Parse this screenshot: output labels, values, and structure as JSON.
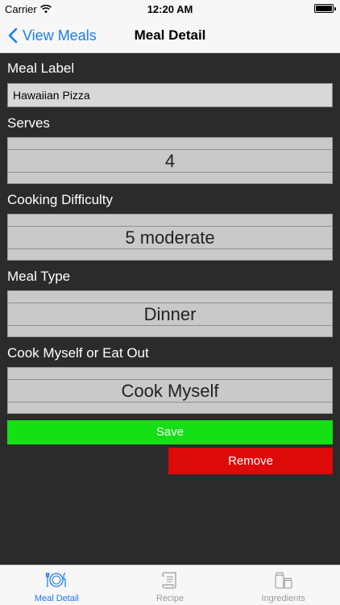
{
  "status_bar": {
    "carrier": "Carrier",
    "time": "12:20 AM"
  },
  "nav": {
    "back_label": "View Meals",
    "title": "Meal Detail"
  },
  "form": {
    "meal_label": {
      "label": "Meal Label",
      "value": "Hawaiian Pizza"
    },
    "serves": {
      "label": "Serves",
      "value": "4"
    },
    "difficulty": {
      "label": "Cooking Difficulty",
      "value": "5 moderate"
    },
    "meal_type": {
      "label": "Meal Type",
      "value": "Dinner"
    },
    "cook_or_eat": {
      "label": "Cook Myself or Eat Out",
      "value": "Cook Myself"
    }
  },
  "actions": {
    "save_label": "Save",
    "remove_label": "Remove",
    "save_color": "#14e014",
    "remove_color": "#dd0a0a"
  },
  "tabs": [
    {
      "label": "Meal Detail",
      "icon": "plate-cutlery-icon",
      "active": true
    },
    {
      "label": "Recipe",
      "icon": "scroll-icon",
      "active": false
    },
    {
      "label": "Ingredients",
      "icon": "jars-icon",
      "active": false
    }
  ],
  "accent_color": "#1a7cf5"
}
